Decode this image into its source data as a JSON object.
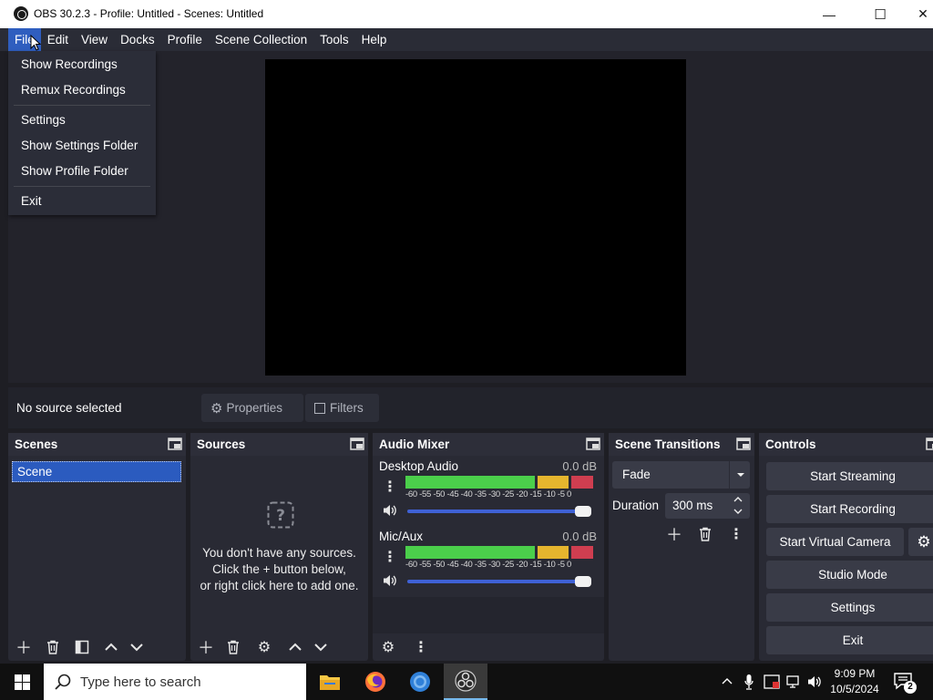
{
  "window": {
    "title": "OBS 30.2.3 - Profile: Untitled - Scenes: Untitled",
    "buttons": {
      "minimize": "—",
      "maximize": "☐",
      "close": "✕"
    }
  },
  "menubar": {
    "items": [
      "File",
      "Edit",
      "View",
      "Docks",
      "Profile",
      "Scene Collection",
      "Tools",
      "Help"
    ],
    "active": "File"
  },
  "file_menu": {
    "items": [
      "Show Recordings",
      "Remux Recordings",
      "Settings",
      "Show Settings Folder",
      "Show Profile Folder",
      "Exit"
    ]
  },
  "context_bar": {
    "status": "No source selected",
    "properties_label": "Properties",
    "filters_label": "Filters"
  },
  "scenes": {
    "title": "Scenes",
    "items": [
      "Scene"
    ]
  },
  "sources": {
    "title": "Sources",
    "empty_line1": "You don't have any sources.",
    "empty_line2": "Click the + button below,",
    "empty_line3": "or right click here to add one."
  },
  "audio_mixer": {
    "title": "Audio Mixer",
    "scale": "-60 -55 -50 -45 -40 -35 -30 -25 -20 -15 -10 -5 0",
    "channels": [
      {
        "name": "Desktop Audio",
        "level": "0.0 dB",
        "volume": 1.0
      },
      {
        "name": "Mic/Aux",
        "level": "0.0 dB",
        "volume": 1.0
      }
    ]
  },
  "transitions": {
    "title": "Scene Transitions",
    "selected": "Fade",
    "duration_label": "Duration",
    "duration_value": "300 ms"
  },
  "controls": {
    "title": "Controls",
    "start_streaming": "Start Streaming",
    "start_recording": "Start Recording",
    "start_virtual_camera": "Start Virtual Camera",
    "studio_mode": "Studio Mode",
    "settings": "Settings",
    "exit": "Exit"
  },
  "taskbar": {
    "search_placeholder": "Type here to search",
    "time": "9:09 PM",
    "date": "10/5/2024",
    "notification_count": "2"
  },
  "colors": {
    "accent": "#2f5ebf",
    "meter_green": "#4bcf4b",
    "meter_yellow": "#e5b52e",
    "meter_red": "#cf3e50",
    "volume_blue": "#3f61d5"
  }
}
